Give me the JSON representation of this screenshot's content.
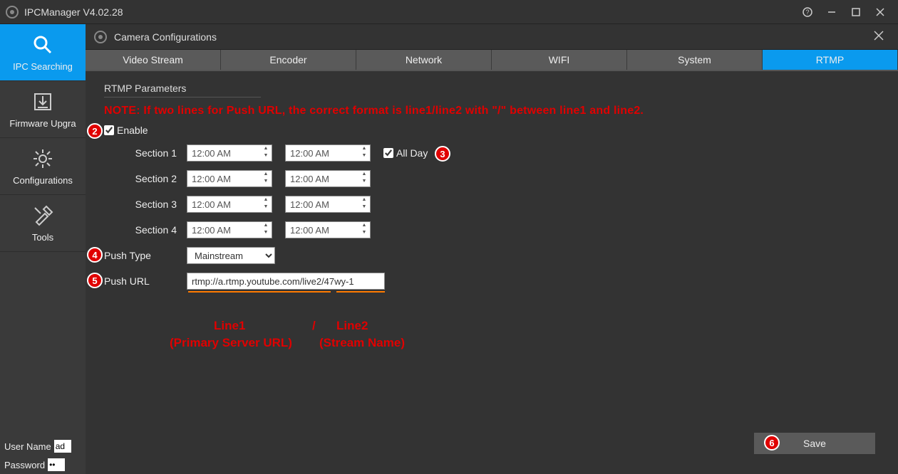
{
  "titlebar": {
    "title": "IPCManager V4.02.28"
  },
  "sidebar": {
    "items": [
      {
        "label": "IPC Searching"
      },
      {
        "label": "Firmware Upgra"
      },
      {
        "label": "Configurations"
      },
      {
        "label": "Tools"
      }
    ]
  },
  "credentials": {
    "username_label": "User Name",
    "username_value": "ad",
    "password_label": "Password",
    "password_value": "••"
  },
  "dialog": {
    "title": "Camera Configurations",
    "tabs": [
      "Video Stream",
      "Encoder",
      "Network",
      "WIFI",
      "System",
      "RTMP"
    ],
    "active_tab": 5
  },
  "form": {
    "section_title": "RTMP Parameters",
    "note": "NOTE: If two lines for Push URL, the correct format is line1/line2 with \"/\" between line1 and line2.",
    "enable_label": "Enable",
    "enable_checked": true,
    "sections": [
      {
        "label": "Section 1",
        "start": "12:00 AM",
        "end": "12:00 AM",
        "allday": true
      },
      {
        "label": "Section 2",
        "start": "12:00 AM",
        "end": "12:00 AM"
      },
      {
        "label": "Section 3",
        "start": "12:00 AM",
        "end": "12:00 AM"
      },
      {
        "label": "Section 4",
        "start": "12:00 AM",
        "end": "12:00 AM"
      }
    ],
    "allday_label": "All Day",
    "push_type_label": "Push Type",
    "push_type_value": "Mainstream",
    "push_url_label": "Push URL",
    "push_url_value": "rtmp://a.rtmp.youtube.com/live2/47wy-1",
    "annot_line1": "Line1",
    "annot_slash": "/",
    "annot_line2": "Line2",
    "annot_sub1": "(Primary Server URL)",
    "annot_sub2": "(Stream Name)",
    "save_label": "Save"
  }
}
